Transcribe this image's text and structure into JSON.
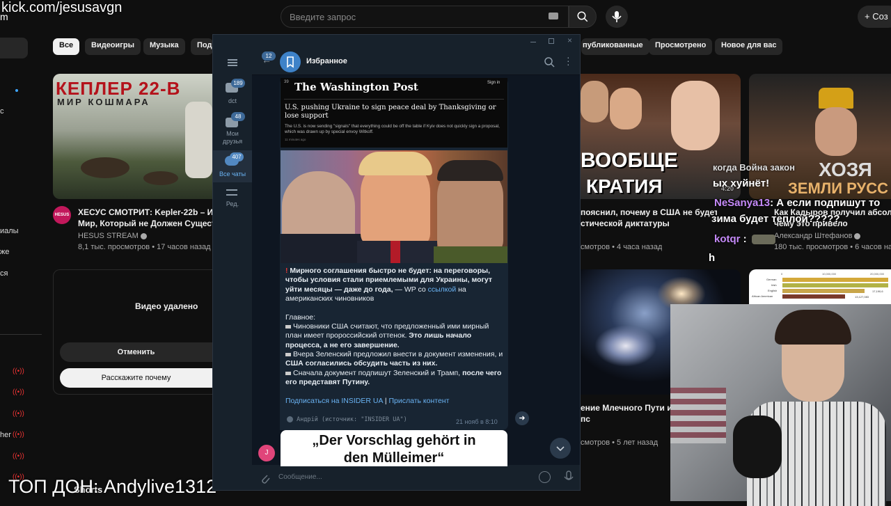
{
  "youtube": {
    "search_placeholder": "Введите запрос",
    "create_label": "Соз",
    "chips": [
      "Все",
      "Видеоигры",
      "Музыка",
      "Подк",
      "публикованные",
      "Просмотрено",
      "Новое для вас"
    ],
    "sidebar_texts": [
      "c",
      "иалы",
      "же",
      "ся",
      "her"
    ],
    "video1": {
      "thumb_title": "КЕПЛЕР 22-В",
      "thumb_subtitle": "МИР КОШМАРА",
      "title_line1": "ХЕСУС СМОТРИТ: Kepler-22b – Ин",
      "title_line2": "Мир, Который не Должен Сущест",
      "channel": "HESUS STREAM",
      "meta": "8,1 тыс. просмотров • 17 часов назад",
      "avatar_text": "HESUS"
    },
    "video2": {
      "thumb_text1": "ВООБЩЕ",
      "thumb_text2": "КРАТИЯ",
      "title_line1": "пояснил, почему в США не будет",
      "title_line2": "стической диктатуры",
      "meta": "смотров • 4 часа назад"
    },
    "video3": {
      "thumb_text1": "ХОЗЯ",
      "thumb_text2": "ЗЕМЛИ РУСС",
      "title_line1": "Как Кадыров получил абсолю",
      "title_line2": "чему это привело",
      "channel": "Александр Штефанов",
      "meta": "180 тыс. просмотров • 6 часов на"
    },
    "video4": {
      "title_line1": "ение Млечного Пути и",
      "title_line2": "пс",
      "meta": "смотров • 5 лет назад"
    },
    "video5": {
      "chart_labels": [
        "German",
        "Irish",
        "English",
        "African American"
      ],
      "chart_ticks": [
        "0",
        "10,000,000",
        "20,000,000"
      ],
      "chart_values": [
        "17,190,6",
        "13,127,083"
      ]
    },
    "deleted_label": "Видео удалено",
    "cancel_label": "Отменить",
    "tell_why_label": "Расскажите почему",
    "shorts_label": "Shorts"
  },
  "stream": {
    "url": "kick.com/jesusavgn",
    "url_sub": "m",
    "bottom_text": "ТОП ДОН: Andylive1312",
    "chat_line0": "когда Война закон",
    "chat_line0_tail": "ых хуйнёт!",
    "chat_user1": "NeSanya13",
    "chat_msg1_line1": ": А если подпишут то",
    "chat_msg1_line2": "зима будет теплой?????",
    "chat_user2": "kotqr",
    "chat_msg2": ":",
    "chat_line3": "h",
    "chat_time": "4:20"
  },
  "telegram": {
    "chat_title": "Избранное",
    "back_badge": "12",
    "folders": [
      {
        "label": "dct",
        "badge": "189"
      },
      {
        "label": "Мои друзья",
        "badge": "48"
      },
      {
        "label": "Все чаты",
        "badge": "407"
      },
      {
        "label": "Ред.",
        "badge": ""
      }
    ],
    "wp_logo": "The Washington Post",
    "wp_signin": "Sign in",
    "wp_num": "39",
    "wp_headline": "U.S. pushing Ukraine to sign peace deal by Thanksgiving or lose support",
    "wp_sub": "The U.S. is now sending \"signals\" that everything could be off the table if Kyiv does not quickly sign a proposal, which was drawn up by special envoy Witkoff.",
    "wp_time": "11 minutes ago",
    "msg_lead": "Мирного соглашения быстро не будет: на переговоры, чтобы условия стали приемлемыми для Украины, могут уйти месяцы — даже до года,",
    "msg_lead_tail1": " — WP со ",
    "msg_link": "ссылкой",
    "msg_lead_tail2": " на американских чиновников",
    "msg_main": "Главное:",
    "b1_plain": "Чиновники США считают, что предложенный ими мирный план имеет пророссийский оттенок. ",
    "b1_bold": "Это лишь начало процесса, а не его завершение.",
    "b2_plain": "Вчера Зеленский предложил внести в документ изменения, и ",
    "b2_bold": "США согласились обсудить часть из них.",
    "b3_plain": "Сначала документ подпишут Зеленский и Трамп, ",
    "b3_bold": "после чего его представят Путину.",
    "subscribe": "Подписаться на INSIDER UA",
    "separator": "|",
    "send_content": "Прислать контент",
    "forward_from": "Андрій (источник: \"INSIDER UA\")",
    "msg_time": "21 нояб в 8:10",
    "next_headline": "„Der Vorschlag gehört in den Mülleimer“",
    "avatar_letter": "J",
    "composer_placeholder": "Сообщение..."
  },
  "colors": {
    "tg_bg": "#0e1621",
    "tg_panel": "#17212b",
    "tg_accent": "#5288c1",
    "tg_link": "#6ab3f3",
    "yt_bg": "#0f0f0f",
    "chat_user_color": "#c58af9"
  }
}
